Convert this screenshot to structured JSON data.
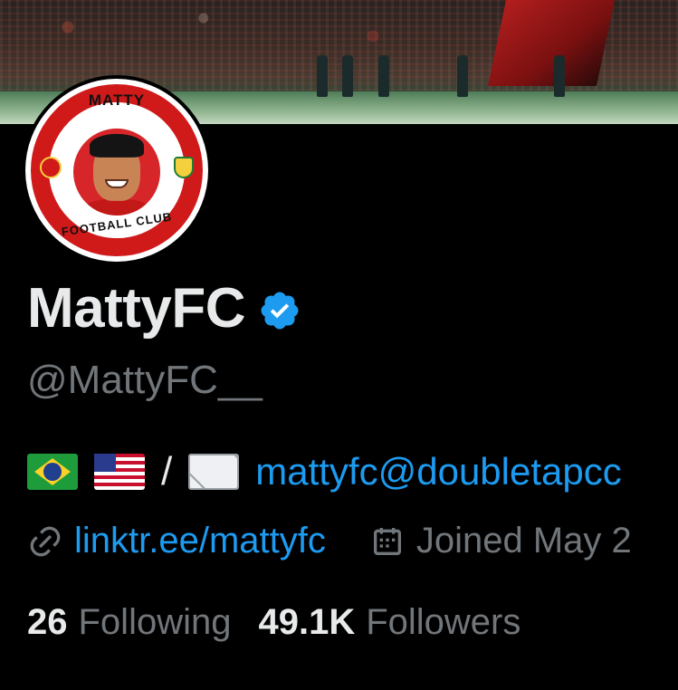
{
  "profile": {
    "display_name": "MattyFC",
    "handle": "@MattyFC__",
    "verified": true,
    "avatar_text_top": "MATTY",
    "avatar_text_bottom": "FOOTBALL CLUB"
  },
  "bio": {
    "separator": "/",
    "email": "mattyfc@doubletapcc",
    "icons": [
      "flag-brazil-icon",
      "flag-usa-icon",
      "envelope-icon"
    ]
  },
  "meta": {
    "link": "linktr.ee/mattyfc",
    "joined": "Joined May 2"
  },
  "stats": {
    "following_count": "26",
    "following_label": "Following",
    "followers_count": "49.1K",
    "followers_label": "Followers"
  },
  "colors": {
    "background": "#000000",
    "accent": "#1d9bf0",
    "muted": "#71767b",
    "text": "#e7e9ea"
  }
}
